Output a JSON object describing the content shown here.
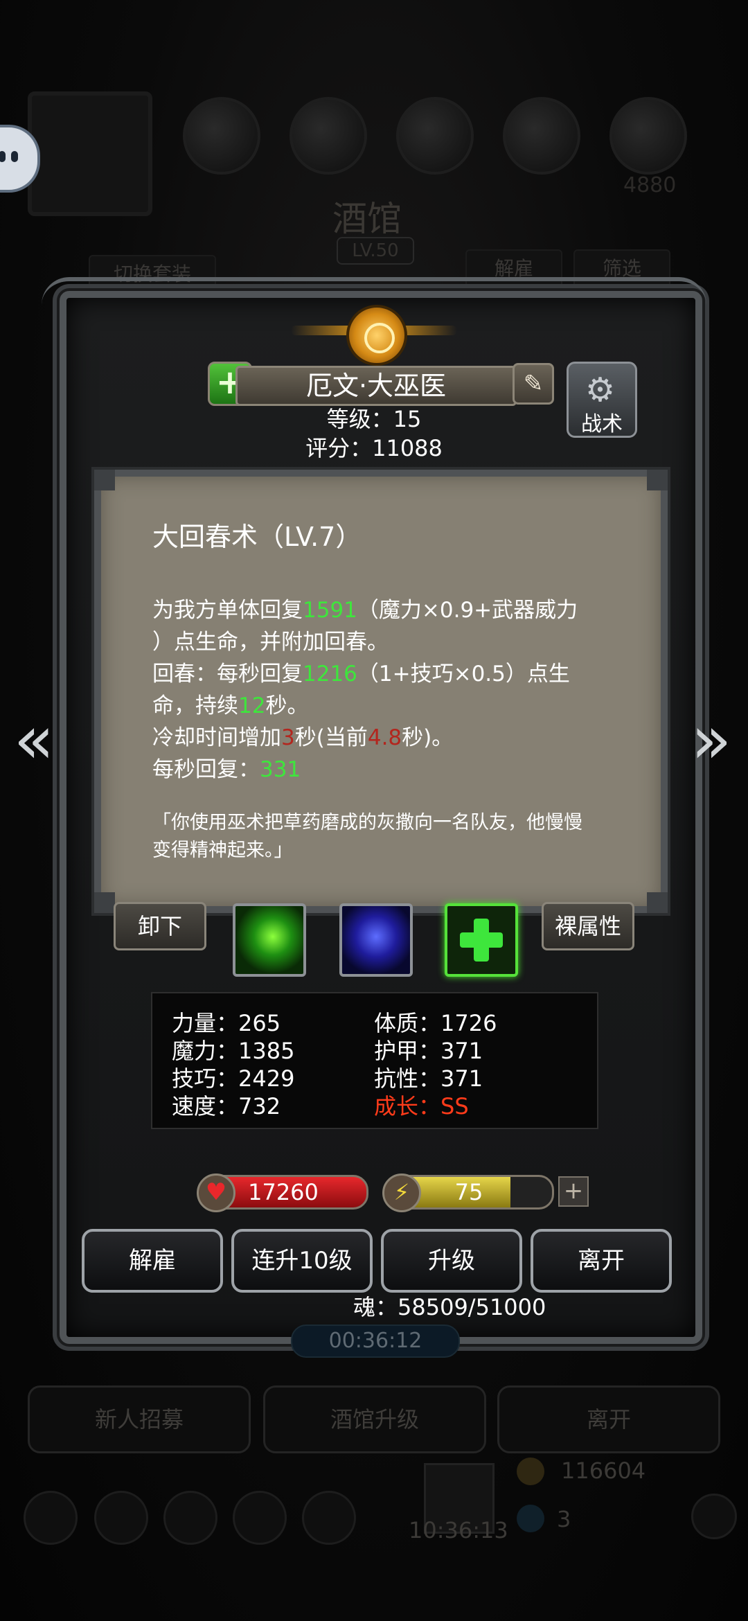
{
  "background": {
    "title": "酒馆",
    "level": "LV.50",
    "switch_outfit": "切换套装",
    "dismiss_tab": "解雇",
    "filter_tab": "筛选",
    "recruit_button": "新人招募",
    "upgrade_tavern_button": "酒馆升级",
    "leave_button": "离开",
    "gold_count": "116604",
    "clock": "10:36:13",
    "gem_count": "3",
    "top_count": "4880"
  },
  "hero": {
    "name": "厄文·大巫医",
    "level_line": "等级：15",
    "score_line": "评分：11088",
    "tactics_label": "战术"
  },
  "skill": {
    "title": "大回春术（LV.7）",
    "line1_a": "为我方单体回复",
    "line1_val": "1591",
    "line1_b": "（魔力×0.9+武器威力",
    "line2": "）点生命，并附加回春。",
    "line3_a": "回春：每秒回复",
    "line3_val": "1216",
    "line3_b": "（1+技巧×0.5）点生",
    "line4_a": "命，持续",
    "line4_val": "12",
    "line4_b": "秒。",
    "line5_a": "冷却时间增加",
    "line5_val": "3",
    "line5_b": "秒(当前",
    "line5_val2": "4.8",
    "line5_c": "秒)。",
    "line6_a": "每秒回复：",
    "line6_val": "331",
    "quote_line1": "「你使用巫术把草药磨成的灰撒向一名队友，他慢慢",
    "quote_line2": "变得精神起来。」"
  },
  "buttons": {
    "unequip": "卸下",
    "bare_stats": "裸属性",
    "dismiss": "解雇",
    "level_up_10": "连升10级",
    "level_up": "升级",
    "leave": "离开"
  },
  "attributes": {
    "strength": "力量：265",
    "constitution": "体质：1726",
    "magic": "魔力：1385",
    "armor": "护甲：371",
    "skill": "技巧：2429",
    "resistance": "抗性：371",
    "speed": "速度：732",
    "growth": "成长：SS"
  },
  "bars": {
    "hp": "17260",
    "energy": "75",
    "energy_fraction": 0.75
  },
  "soul_text": "魂：58509/51000",
  "timer": "00:36:12",
  "colors": {
    "heal_value": "#3ee63c",
    "cooldown_value": "#b3261e",
    "growth": "#ff3b1a"
  }
}
